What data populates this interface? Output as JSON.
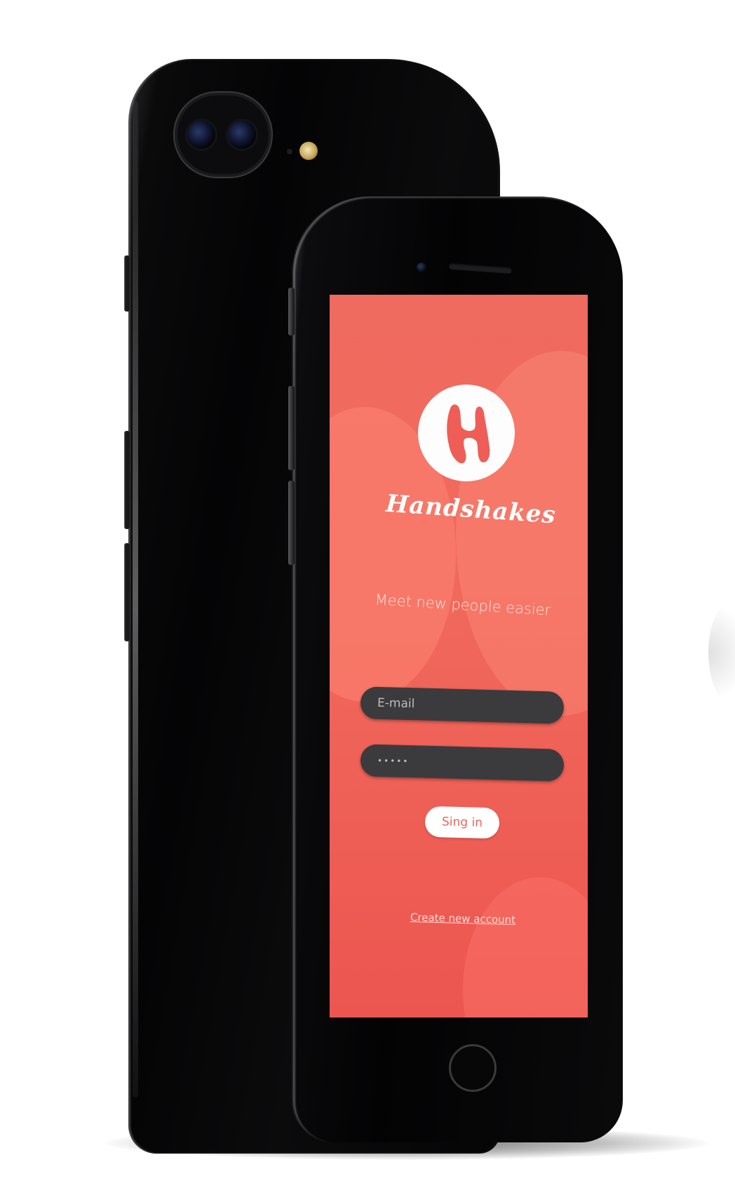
{
  "app": {
    "brand": "Handshakes",
    "tagline": "Meet new people easier"
  },
  "login_form": {
    "email_placeholder": "E-mail",
    "password_value": "•••••",
    "signin_label": "Sing in",
    "create_account_label": "Create new account"
  },
  "icons": {
    "logo": "handshakes-h-logo-icon",
    "front_camera": "front-camera-icon",
    "earpiece": "earpiece-speaker-icon",
    "home": "home-button-icon",
    "rear_camera": "dual-rear-camera-icon",
    "flash": "flash-icon"
  },
  "colors": {
    "screen_top": "#ef6a5f",
    "screen_bottom": "#ec5650",
    "field_bg": "#3b3b3d",
    "button_bg": "#ffffff",
    "button_text": "#ef6459",
    "phone_body": "#050506"
  }
}
